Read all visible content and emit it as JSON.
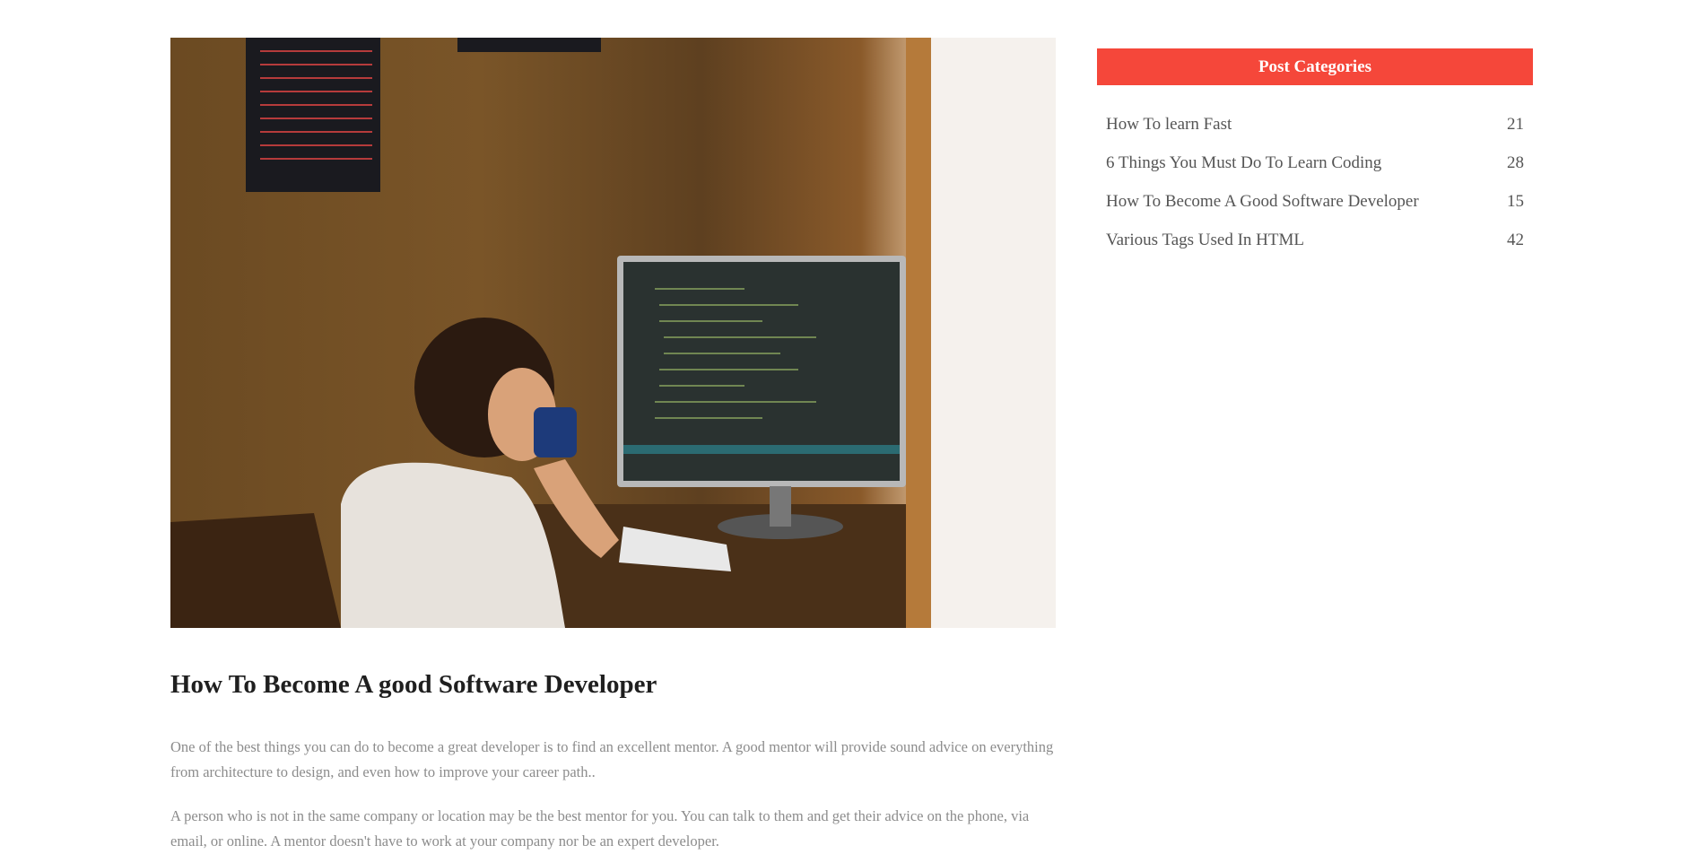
{
  "post": {
    "image_alt": "Boy drinking from a mug in front of a computer monitor showing code",
    "title": "How To Become A good Software Developer",
    "paragraphs": [
      "One of the best things you can do to become a great developer is to find an excellent mentor. A good mentor will provide sound advice on everything from architecture to design, and even how to improve your career path..",
      "A person who is not in the same company or location may be the best mentor for you. You can talk to them and get their advice on the phone, via email, or online. A mentor doesn't have to work at your company nor be an expert developer."
    ]
  },
  "sidebar": {
    "header": "Post Categories",
    "categories": [
      {
        "label": "How To learn Fast",
        "count": "21"
      },
      {
        "label": "6 Things You Must Do To Learn Coding",
        "count": "28"
      },
      {
        "label": "How To Become A Good Software Developer",
        "count": "15"
      },
      {
        "label": "Various Tags Used In HTML",
        "count": "42"
      }
    ]
  },
  "colors": {
    "accent": "#f5473a",
    "title_text": "#1f1f1f",
    "body_text": "#8c8c8c",
    "category_text": "#555555"
  }
}
